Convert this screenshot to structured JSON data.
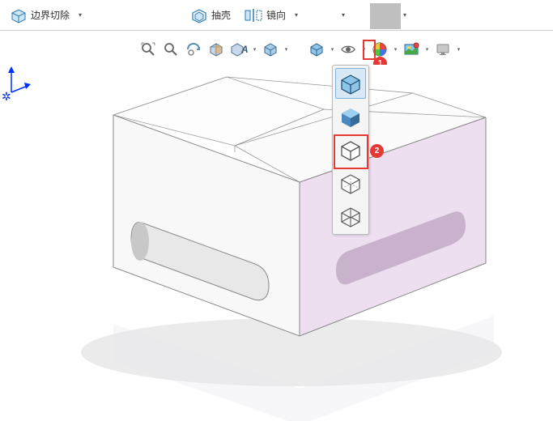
{
  "toolbar": {
    "boundary_cut": "边界切除",
    "shell": "抽壳",
    "mirror": "镜向"
  },
  "viewbar": {
    "icons": [
      "zoom-fit-icon",
      "zoom-area-icon",
      "prev-view-icon",
      "section-icon",
      "annotation-view-icon",
      "view-orient-icon",
      "display-style-icon",
      "hide-show-icon",
      "appearance-icon",
      "scene-icon",
      "view-settings-icon"
    ]
  },
  "display_styles": {
    "options": [
      "shaded-edges",
      "shaded",
      "hidden-removed",
      "hidden-visible",
      "wireframe"
    ]
  },
  "callouts": {
    "dropdown": "1",
    "option": "2"
  }
}
